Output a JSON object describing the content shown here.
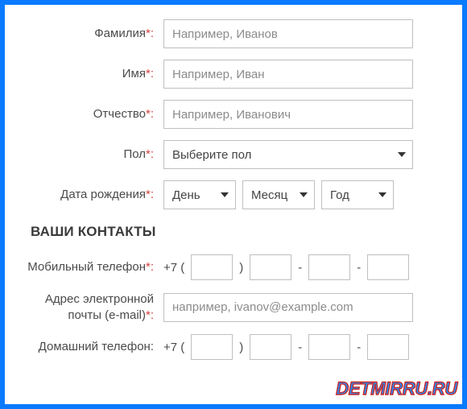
{
  "fields": {
    "lastname": {
      "label": "Фамилия",
      "required": true,
      "placeholder": "Например, Иванов"
    },
    "firstname": {
      "label": "Имя",
      "required": true,
      "placeholder": "Например, Иван"
    },
    "patronymic": {
      "label": "Отчество",
      "required": true,
      "placeholder": "Например, Иванович"
    },
    "gender": {
      "label": "Пол",
      "required": true,
      "placeholder": "Выберите пол"
    },
    "birthdate": {
      "label": "Дата рождения",
      "required": true,
      "day": "День",
      "month": "Месяц",
      "year": "Год"
    }
  },
  "contacts_section": "ВАШИ КОНТАКТЫ",
  "contacts": {
    "mobile": {
      "label": "Мобильный телефон",
      "required": true,
      "prefix": "+7 (",
      "after_area": ")",
      "sep": "-"
    },
    "email": {
      "label": "Адрес электронной почты (e-mail)",
      "required": true,
      "placeholder": "например, ivanov@example.com"
    },
    "home": {
      "label": "Домашний телефон:",
      "required": false,
      "prefix": "+7 (",
      "after_area": ")",
      "sep": "-"
    }
  },
  "required_marker": "*:",
  "colon": ":",
  "watermark": "DETMIRRU.RU"
}
